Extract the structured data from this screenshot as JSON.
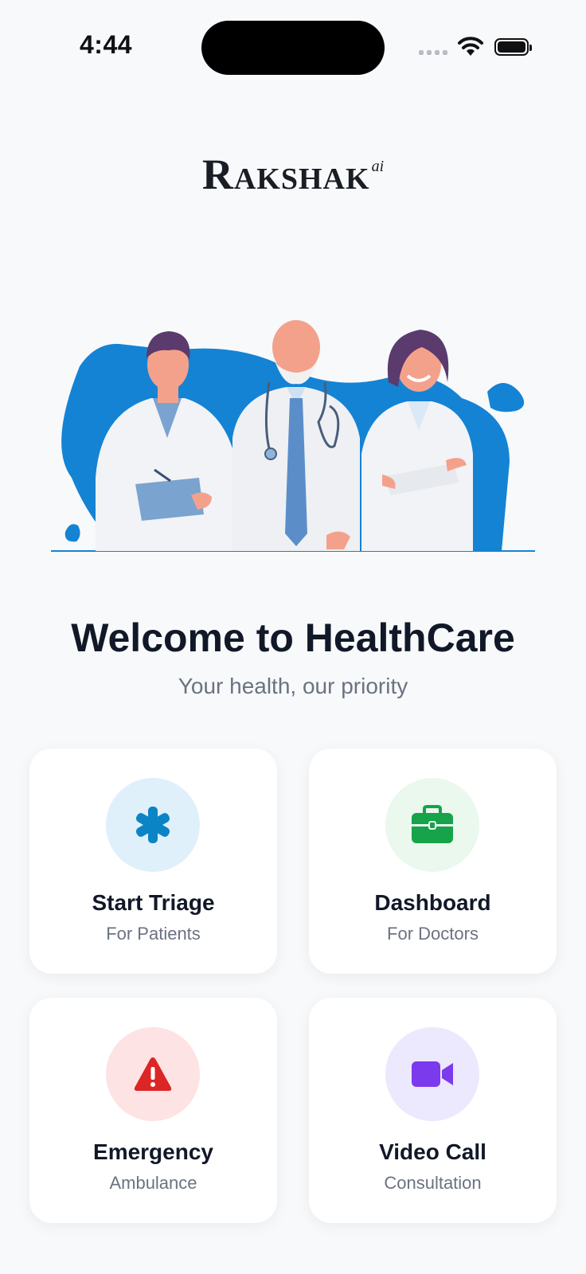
{
  "status_bar": {
    "time": "4:44"
  },
  "brand": {
    "initial": "R",
    "rest": "AKSHAK",
    "suffix": "ai"
  },
  "welcome": {
    "title": "Welcome to HealthCare",
    "subtitle": "Your health, our priority"
  },
  "cards": [
    {
      "title": "Start Triage",
      "subtitle": "For Patients",
      "icon": "asterisk-medical-icon",
      "color": "#0b84c6",
      "bg": "#dff0fb"
    },
    {
      "title": "Dashboard",
      "subtitle": "For Doctors",
      "icon": "briefcase-medical-icon",
      "color": "#16a34a",
      "bg": "#eaf8ee"
    },
    {
      "title": "Emergency",
      "subtitle": "Ambulance",
      "icon": "warning-triangle-icon",
      "color": "#dc2626",
      "bg": "#fde3e3"
    },
    {
      "title": "Video Call",
      "subtitle": "Consultation",
      "icon": "video-camera-icon",
      "color": "#7c3aed",
      "bg": "#ece8fd"
    }
  ],
  "colors": {
    "accent_blue": "#1483d4",
    "background": "#f7f9fb"
  }
}
